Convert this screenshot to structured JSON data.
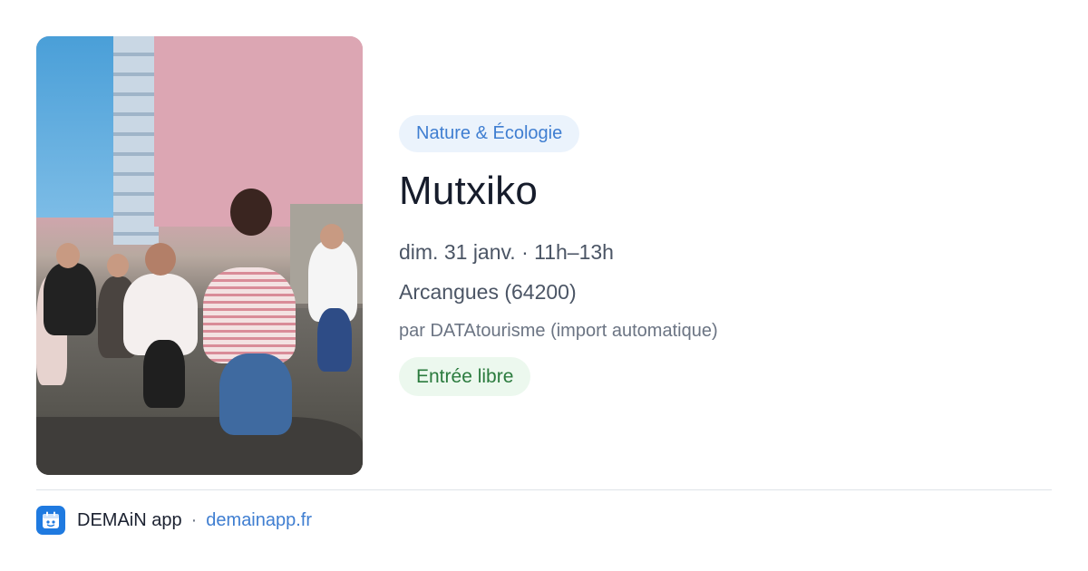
{
  "event": {
    "category": "Nature & Écologie",
    "title": "Mutxiko",
    "date_time": "dim. 31 janv. · 11h–13h",
    "location": "Arcangues (64200)",
    "organizer": "par DATAtourisme (import automatique)",
    "price": "Entrée libre"
  },
  "footer": {
    "app_name": "DEMAiN app",
    "separator": "·",
    "site": "demainapp.fr"
  },
  "colors": {
    "category_chip_bg": "#ebf3fc",
    "category_chip_text": "#3f7ed1",
    "price_chip_bg": "#ecf8ee",
    "price_chip_text": "#2b7b3e",
    "brand_blue": "#1f7ae0"
  },
  "icons": {
    "app_icon": "calendar-app-icon"
  }
}
